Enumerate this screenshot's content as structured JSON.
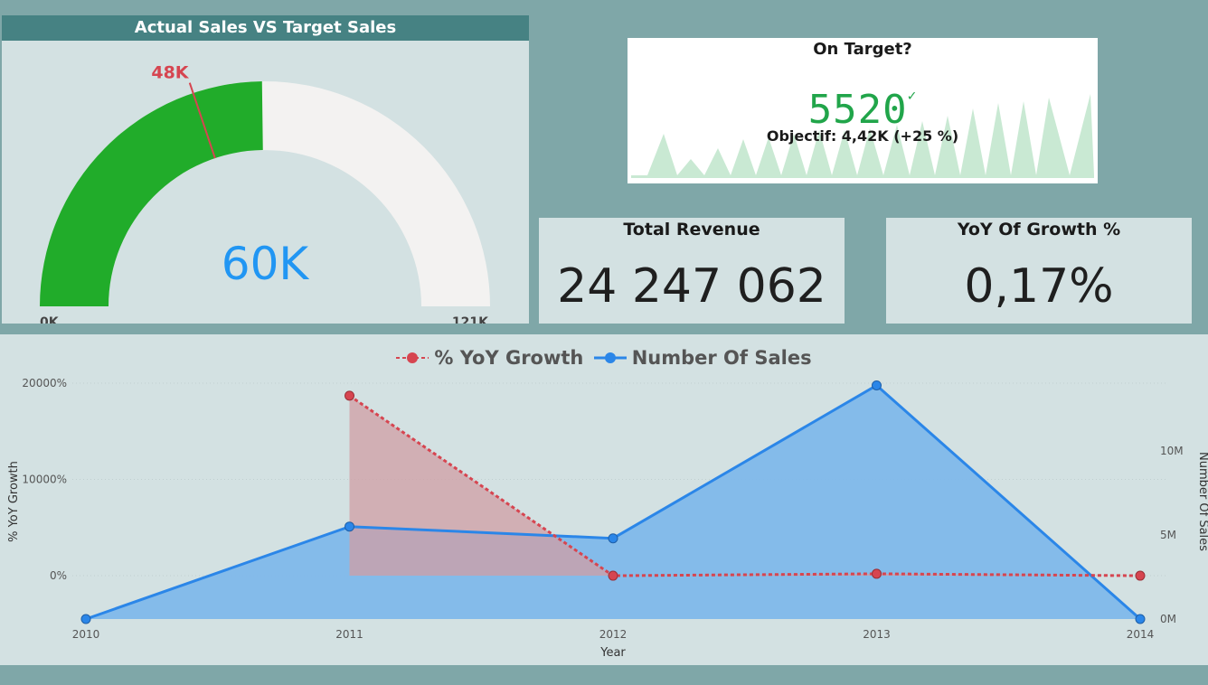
{
  "gauge": {
    "title": "Actual Sales VS Target Sales",
    "value_label": "60K",
    "target_label": "48K",
    "min_label": "0K",
    "max_label": "121K",
    "value": 60,
    "target": 48,
    "min": 0,
    "max": 121,
    "fill_color": "#21ac2a",
    "track_color": "#f3f2f1",
    "target_color": "#d64550",
    "value_color": "#2196f3"
  },
  "on_target": {
    "title": "On Target?",
    "value": "5520",
    "check_icon": "check-icon",
    "check_glyph": "✓",
    "goal": "Objectif: 4,42K (+25 %)",
    "value_color": "#21a54a",
    "spark_color": "#c9e9d3"
  },
  "total_revenue": {
    "title": "Total Revenue",
    "value": "24 247 062"
  },
  "yoy": {
    "title": "YoY Of Growth %",
    "value": "0,17%"
  },
  "chart_data": {
    "type": "area",
    "xlabel": "Year",
    "categories": [
      "2010",
      "2011",
      "2012",
      "2013",
      "2014"
    ],
    "y_left_label": "% YoY Growth",
    "y_right_label": "Number Of Sales",
    "y_left_ticks": [
      "20000%",
      "10000%",
      "0%"
    ],
    "y_right_ticks": [
      "10M",
      "5M",
      "0M"
    ],
    "y_left_range": [
      -4500,
      20000
    ],
    "y_right_range": [
      0,
      10000000
    ],
    "legend_position": "top-center",
    "series": [
      {
        "name": "% YoY Growth",
        "axis": "left",
        "style": "dashed",
        "color": "#d64550",
        "fill": "#d09ea4",
        "values": [
          null,
          18700,
          0,
          200,
          0
        ]
      },
      {
        "name": "Number Of Sales",
        "axis": "right",
        "style": "solid",
        "color": "#2b86e8",
        "fill": "#7fb8ea",
        "values": [
          0,
          5500000,
          4800000,
          13900000,
          0
        ]
      }
    ]
  }
}
